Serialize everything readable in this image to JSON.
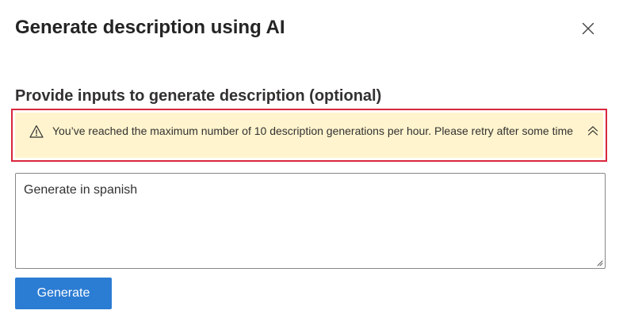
{
  "dialog": {
    "title": "Generate description using AI",
    "close_icon": "close-icon"
  },
  "form": {
    "heading": "Provide inputs to generate description (optional)",
    "prompt_value": "Generate in spanish",
    "generate_label": "Generate"
  },
  "warning": {
    "icon": "warning-icon",
    "message": "You’ve reached the maximum number of 10 description generations per hour. Please retry after some time",
    "collapse_icon": "chevron-double-up-icon"
  },
  "colors": {
    "accent": "#2b7cd3",
    "warning_background": "#fff4ce",
    "highlight_border": "#d8273c"
  }
}
